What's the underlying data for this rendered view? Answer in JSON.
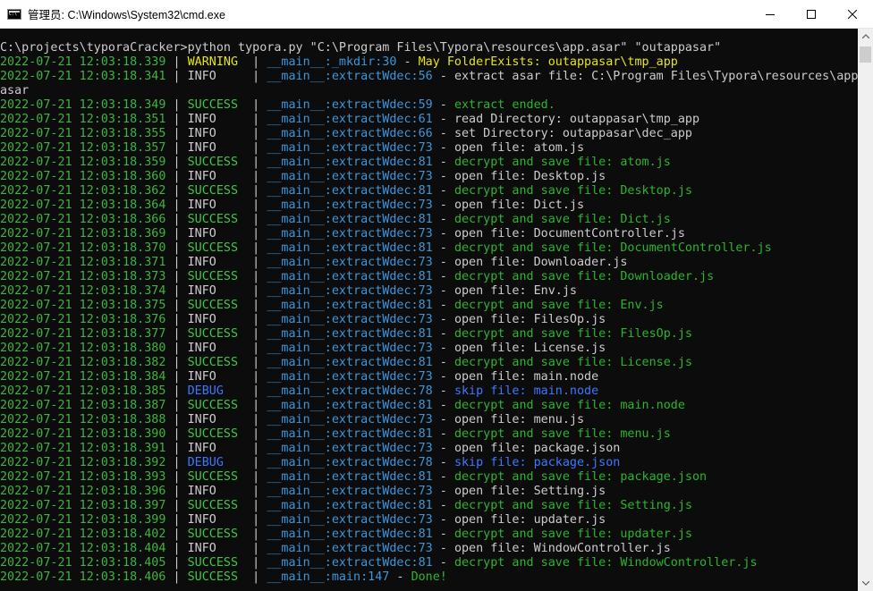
{
  "window": {
    "title": "管理员: C:\\Windows\\System32\\cmd.exe",
    "icon": "cmd-icon",
    "buttons": [
      "minimize-icon",
      "maximize-icon",
      "close-icon"
    ]
  },
  "colors": {
    "background": "#0c0c0c",
    "timestamp": "#3fb33f",
    "warning": "#e5e510",
    "info": "#cccccc",
    "success": "#3fc93f",
    "debug": "#3b78ff",
    "module": "#3a96dd"
  },
  "console": {
    "command": "C:\\projects\\typoraCracker>python typora.py \"C:\\Program Files\\Typora\\resources\\app.asar\" \"outappasar\"",
    "wrap_continuation": "asar",
    "logs": [
      {
        "time": "2022-07-21 12:03:18.339",
        "level": "WARNING",
        "module": "__main__:_mkdir:30",
        "message": "May FolderExists: outappasar\\tmp_app"
      },
      {
        "time": "2022-07-21 12:03:18.341",
        "level": "INFO",
        "module": "__main__:extractWdec:56",
        "message": "extract asar file: C:\\Program Files\\Typora\\resources\\app."
      },
      {
        "time": "2022-07-21 12:03:18.349",
        "level": "SUCCESS",
        "module": "__main__:extractWdec:59",
        "message": "extract ended."
      },
      {
        "time": "2022-07-21 12:03:18.351",
        "level": "INFO",
        "module": "__main__:extractWdec:61",
        "message": "read Directory: outappasar\\tmp_app"
      },
      {
        "time": "2022-07-21 12:03:18.355",
        "level": "INFO",
        "module": "__main__:extractWdec:66",
        "message": "set Directory: outappasar\\dec_app"
      },
      {
        "time": "2022-07-21 12:03:18.357",
        "level": "INFO",
        "module": "__main__:extractWdec:73",
        "message": "open file: atom.js"
      },
      {
        "time": "2022-07-21 12:03:18.359",
        "level": "SUCCESS",
        "module": "__main__:extractWdec:81",
        "message": "decrypt and save file: atom.js"
      },
      {
        "time": "2022-07-21 12:03:18.360",
        "level": "INFO",
        "module": "__main__:extractWdec:73",
        "message": "open file: Desktop.js"
      },
      {
        "time": "2022-07-21 12:03:18.362",
        "level": "SUCCESS",
        "module": "__main__:extractWdec:81",
        "message": "decrypt and save file: Desktop.js"
      },
      {
        "time": "2022-07-21 12:03:18.364",
        "level": "INFO",
        "module": "__main__:extractWdec:73",
        "message": "open file: Dict.js"
      },
      {
        "time": "2022-07-21 12:03:18.366",
        "level": "SUCCESS",
        "module": "__main__:extractWdec:81",
        "message": "decrypt and save file: Dict.js"
      },
      {
        "time": "2022-07-21 12:03:18.369",
        "level": "INFO",
        "module": "__main__:extractWdec:73",
        "message": "open file: DocumentController.js"
      },
      {
        "time": "2022-07-21 12:03:18.370",
        "level": "SUCCESS",
        "module": "__main__:extractWdec:81",
        "message": "decrypt and save file: DocumentController.js"
      },
      {
        "time": "2022-07-21 12:03:18.371",
        "level": "INFO",
        "module": "__main__:extractWdec:73",
        "message": "open file: Downloader.js"
      },
      {
        "time": "2022-07-21 12:03:18.373",
        "level": "SUCCESS",
        "module": "__main__:extractWdec:81",
        "message": "decrypt and save file: Downloader.js"
      },
      {
        "time": "2022-07-21 12:03:18.374",
        "level": "INFO",
        "module": "__main__:extractWdec:73",
        "message": "open file: Env.js"
      },
      {
        "time": "2022-07-21 12:03:18.375",
        "level": "SUCCESS",
        "module": "__main__:extractWdec:81",
        "message": "decrypt and save file: Env.js"
      },
      {
        "time": "2022-07-21 12:03:18.376",
        "level": "INFO",
        "module": "__main__:extractWdec:73",
        "message": "open file: FilesOp.js"
      },
      {
        "time": "2022-07-21 12:03:18.377",
        "level": "SUCCESS",
        "module": "__main__:extractWdec:81",
        "message": "decrypt and save file: FilesOp.js"
      },
      {
        "time": "2022-07-21 12:03:18.380",
        "level": "INFO",
        "module": "__main__:extractWdec:73",
        "message": "open file: License.js"
      },
      {
        "time": "2022-07-21 12:03:18.382",
        "level": "SUCCESS",
        "module": "__main__:extractWdec:81",
        "message": "decrypt and save file: License.js"
      },
      {
        "time": "2022-07-21 12:03:18.384",
        "level": "INFO",
        "module": "__main__:extractWdec:73",
        "message": "open file: main.node"
      },
      {
        "time": "2022-07-21 12:03:18.385",
        "level": "DEBUG",
        "module": "__main__:extractWdec:78",
        "message": "skip file: main.node"
      },
      {
        "time": "2022-07-21 12:03:18.387",
        "level": "SUCCESS",
        "module": "__main__:extractWdec:81",
        "message": "decrypt and save file: main.node"
      },
      {
        "time": "2022-07-21 12:03:18.388",
        "level": "INFO",
        "module": "__main__:extractWdec:73",
        "message": "open file: menu.js"
      },
      {
        "time": "2022-07-21 12:03:18.390",
        "level": "SUCCESS",
        "module": "__main__:extractWdec:81",
        "message": "decrypt and save file: menu.js"
      },
      {
        "time": "2022-07-21 12:03:18.391",
        "level": "INFO",
        "module": "__main__:extractWdec:73",
        "message": "open file: package.json"
      },
      {
        "time": "2022-07-21 12:03:18.392",
        "level": "DEBUG",
        "module": "__main__:extractWdec:78",
        "message": "skip file: package.json"
      },
      {
        "time": "2022-07-21 12:03:18.393",
        "level": "SUCCESS",
        "module": "__main__:extractWdec:81",
        "message": "decrypt and save file: package.json"
      },
      {
        "time": "2022-07-21 12:03:18.396",
        "level": "INFO",
        "module": "__main__:extractWdec:73",
        "message": "open file: Setting.js"
      },
      {
        "time": "2022-07-21 12:03:18.397",
        "level": "SUCCESS",
        "module": "__main__:extractWdec:81",
        "message": "decrypt and save file: Setting.js"
      },
      {
        "time": "2022-07-21 12:03:18.399",
        "level": "INFO",
        "module": "__main__:extractWdec:73",
        "message": "open file: updater.js"
      },
      {
        "time": "2022-07-21 12:03:18.402",
        "level": "SUCCESS",
        "module": "__main__:extractWdec:81",
        "message": "decrypt and save file: updater.js"
      },
      {
        "time": "2022-07-21 12:03:18.404",
        "level": "INFO",
        "module": "__main__:extractWdec:73",
        "message": "open file: WindowController.js"
      },
      {
        "time": "2022-07-21 12:03:18.405",
        "level": "SUCCESS",
        "module": "__main__:extractWdec:81",
        "message": "decrypt and save file: WindowController.js"
      },
      {
        "time": "2022-07-21 12:03:18.406",
        "level": "SUCCESS",
        "module": "__main__:main:147",
        "message": "Done!"
      }
    ]
  }
}
